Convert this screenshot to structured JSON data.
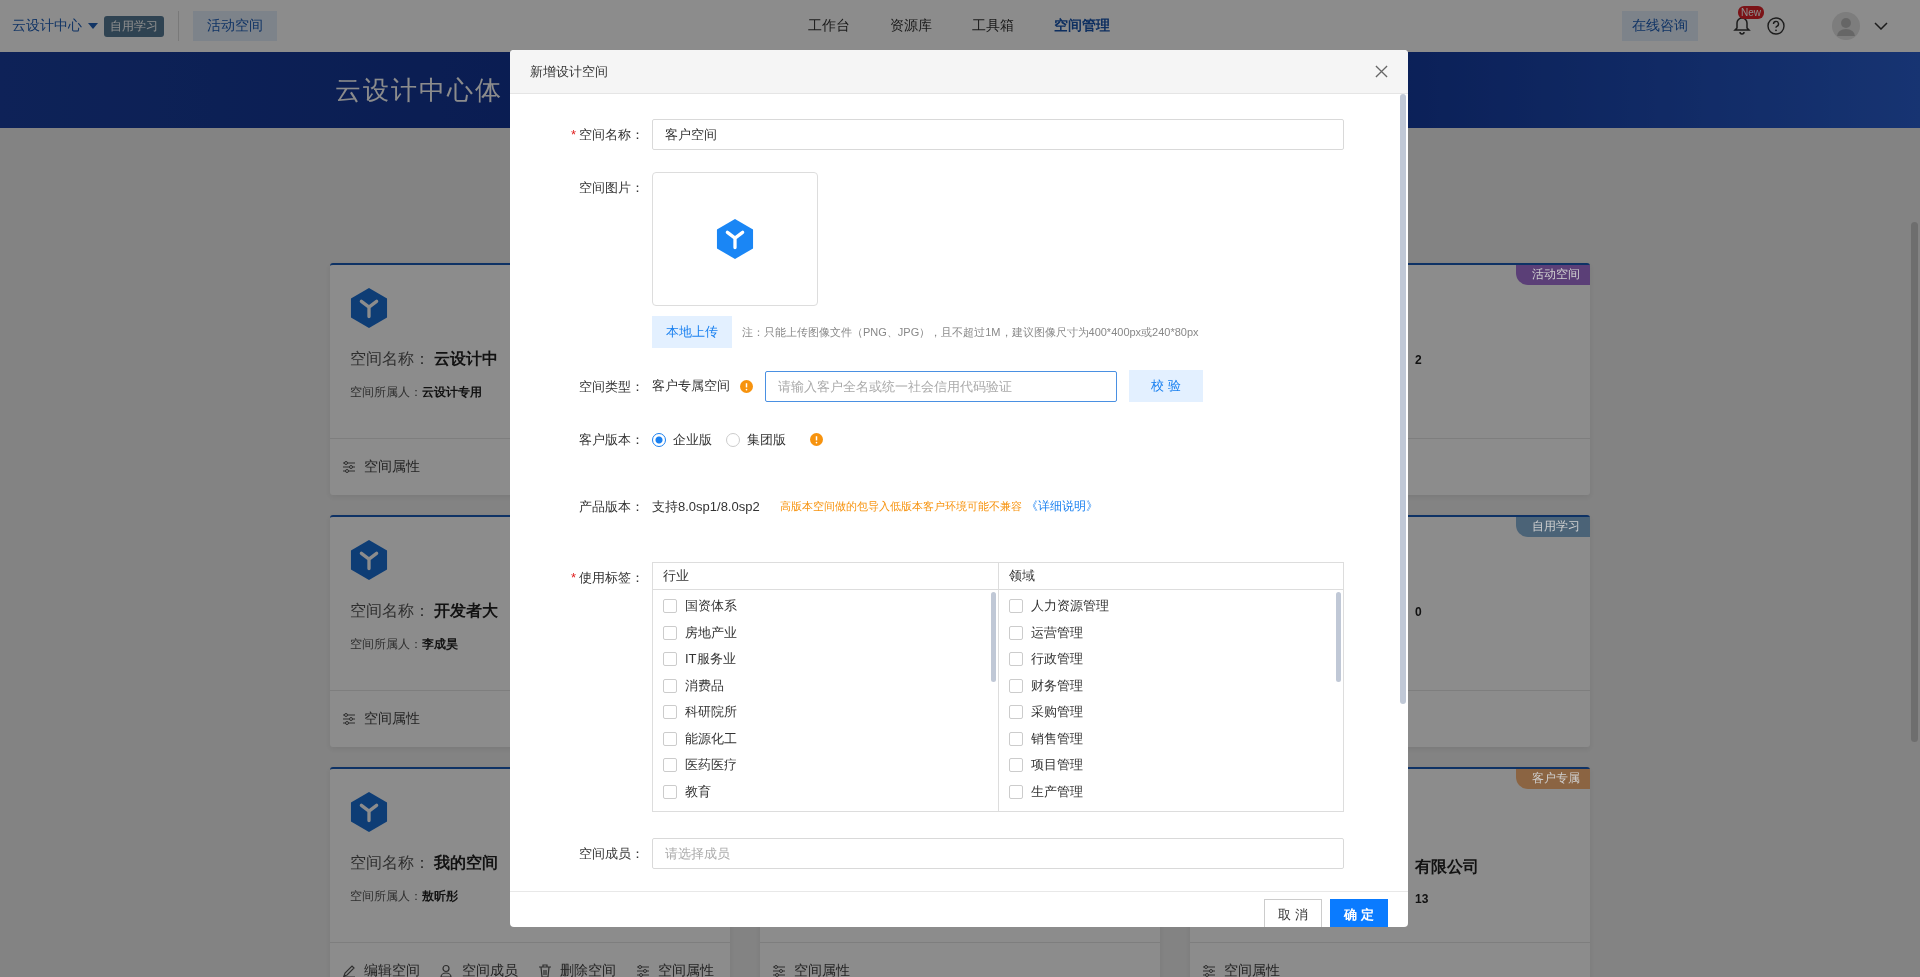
{
  "topbar": {
    "org": "云设计中心",
    "org_badge": "自用学习",
    "space_button": "活动空间",
    "nav": [
      {
        "label": "工作台",
        "selected": false
      },
      {
        "label": "资源库",
        "selected": false
      },
      {
        "label": "工具箱",
        "selected": false
      },
      {
        "label": "空间管理",
        "selected": true
      }
    ],
    "consult": "在线咨询",
    "new_badge": "New"
  },
  "banner": {
    "title": "云设计中心体"
  },
  "card_columns": [
    [
      {
        "name_label": "空间名称：",
        "name": "云设计中",
        "owner_label": "空间所属人：",
        "owner": "云设计专用",
        "actions": [
          {
            "kind": "properties",
            "label": "空间属性"
          }
        ]
      },
      {
        "name_label": "空间名称：",
        "name": "开发者大",
        "owner_label": "空间所属人：",
        "owner": "李成昊",
        "actions": [
          {
            "kind": "properties",
            "label": "空间属性"
          }
        ]
      },
      {
        "name_label": "空间名称：",
        "name": "我的空间",
        "owner_label": "空间所属人：",
        "owner": "敖昕彤",
        "actions": [
          {
            "kind": "edit",
            "label": "编辑空间"
          },
          {
            "kind": "members",
            "label": "空间成员"
          },
          {
            "kind": "delete",
            "label": "删除空间"
          },
          {
            "kind": "properties",
            "label": "空间属性"
          }
        ]
      }
    ],
    [
      {
        "actions": [
          {
            "kind": "properties",
            "label": "空间属性"
          }
        ]
      }
    ],
    [
      {
        "tag": {
          "label": "活动空间",
          "color": "#5b3f77"
        },
        "owner": "2"
      },
      {
        "tag": {
          "label": "自用学习",
          "color": "#4b6377"
        },
        "owner": "0"
      },
      {
        "tag": {
          "label": "客户专属",
          "color": "#8b6442"
        },
        "name": "有限公司",
        "owner": "13",
        "actions": [
          {
            "kind": "properties",
            "label": "空间属性"
          }
        ]
      }
    ]
  ],
  "dialog": {
    "title": "新增设计空间",
    "name": {
      "label": "空间名称：",
      "required_mark": "*",
      "value": "客户空间"
    },
    "image": {
      "label": "空间图片："
    },
    "upload_button": "本地上传",
    "upload_note": "注：只能上传图像文件（PNG、JPG），且不超过1M，建议图像尺寸为400*400px或240*80px",
    "type": {
      "label": "空间类型：",
      "value": "客户专属空间",
      "placeholder": "请输入客户全名或统一社会信用代码验证",
      "verify_button": "校 验"
    },
    "edition": {
      "label": "客户版本：",
      "options": [
        {
          "label": "企业版",
          "selected": true
        },
        {
          "label": "集团版",
          "selected": false
        }
      ]
    },
    "product_version": {
      "label": "产品版本：",
      "value": "支持8.0sp1/8.0sp2",
      "warning": "高版本空间做的包导入低版本客户环境可能不兼容",
      "link": "《详细说明》"
    },
    "tags": {
      "label": "使用标签：",
      "required_mark": "*",
      "columns": [
        {
          "title": "行业",
          "items": [
            {
              "label": "国资体系",
              "checked": false
            },
            {
              "label": "房地产业",
              "checked": false
            },
            {
              "label": "IT服务业",
              "checked": false
            },
            {
              "label": "消费品",
              "checked": false
            },
            {
              "label": "科研院所",
              "checked": false
            },
            {
              "label": "能源化工",
              "checked": false
            },
            {
              "label": "医药医疗",
              "checked": false
            },
            {
              "label": "教育",
              "checked": false
            }
          ]
        },
        {
          "title": "领域",
          "items": [
            {
              "label": "人力资源管理",
              "checked": false
            },
            {
              "label": "运营管理",
              "checked": false
            },
            {
              "label": "行政管理",
              "checked": false
            },
            {
              "label": "财务管理",
              "checked": false
            },
            {
              "label": "采购管理",
              "checked": false
            },
            {
              "label": "销售管理",
              "checked": false
            },
            {
              "label": "项目管理",
              "checked": false
            },
            {
              "label": "生产管理",
              "checked": false
            }
          ]
        }
      ]
    },
    "members": {
      "label": "空间成员：",
      "placeholder": "请选择成员"
    },
    "cancel": "取 消",
    "ok": "确 定"
  }
}
